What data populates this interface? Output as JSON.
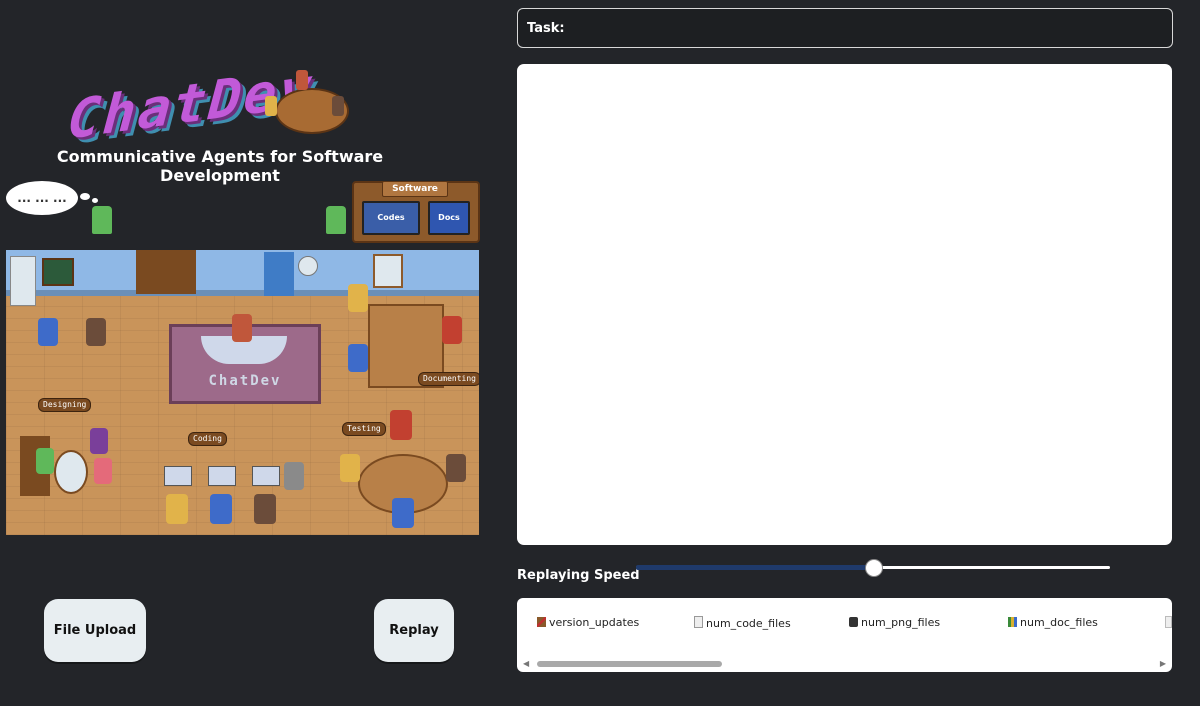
{
  "theme": {
    "background": "#232529",
    "panel": "#ffffff",
    "button": "#e8eef1",
    "slider_fill": "#1f3a6b",
    "logo_purple": "#c25ad8"
  },
  "header": {
    "logo_text": "ChatDev",
    "subtitle": "Communicative Agents for Software Development"
  },
  "scene": {
    "thought_bubble": "... ... ...",
    "software_sign": "Software",
    "codes_label": "Codes",
    "docs_label": "Docs",
    "rug_text": "ChatDev",
    "signs": {
      "designing": "Designing",
      "coding": "Coding",
      "testing": "Testing",
      "documenting": "Documenting"
    }
  },
  "controls": {
    "file_upload_label": "File Upload",
    "replay_label": "Replay"
  },
  "task": {
    "label": "Task:",
    "value": ""
  },
  "speed": {
    "label": "Replaying Speed",
    "value_fraction": 0.5
  },
  "files": {
    "items": [
      {
        "label": "version_updates",
        "icon": "hammer-icon"
      },
      {
        "label": "num_code_files",
        "icon": "document-icon"
      },
      {
        "label": "num_png_files",
        "icon": "image-icon"
      },
      {
        "label": "num_doc_files",
        "icon": "books-icon"
      }
    ]
  }
}
